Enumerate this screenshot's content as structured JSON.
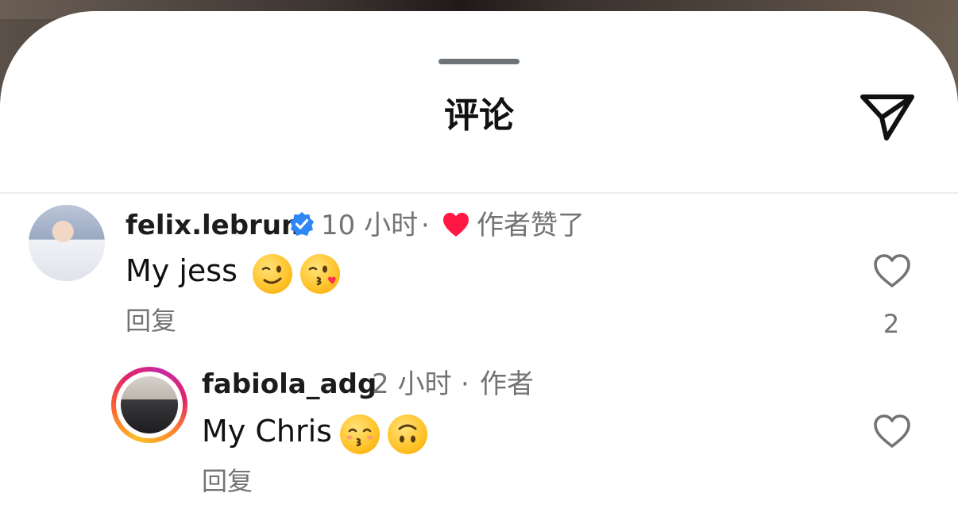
{
  "header": {
    "title": "评论"
  },
  "comments": [
    {
      "username": "felix.lebrun",
      "time": "10 小时",
      "separator": "·",
      "liked_by_author": "作者赞了",
      "text": "My jess",
      "reply_label": "回复",
      "like_count": "2"
    },
    {
      "username": "fabiola_adg",
      "time": "2 小时",
      "separator": "·",
      "author_tag": "作者",
      "text": "My Chris",
      "reply_label": "回复"
    }
  ],
  "colors": {
    "verified": "#2f86f6",
    "liked_heart": "#ff1744",
    "secondary_text": "#737373"
  }
}
